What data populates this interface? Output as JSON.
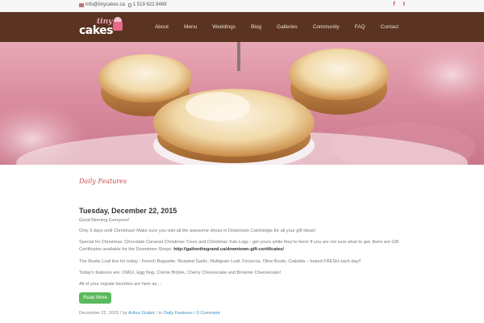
{
  "topbar": {
    "email": "info@tinycakes.ca",
    "phone": "1 519 622 8469",
    "social": [
      {
        "icon": "facebook-icon",
        "glyph": "f"
      },
      {
        "icon": "twitter-icon",
        "glyph": "t"
      }
    ]
  },
  "logo": {
    "word_top": "tiny",
    "word_main": "cakes"
  },
  "nav": {
    "items": [
      "About",
      "Menu",
      "Weddings",
      "Blog",
      "Galleries",
      "Community",
      "FAQ",
      "Contact"
    ]
  },
  "content": {
    "section_title": "Daily Features",
    "post_title": "Tuesday, December 22, 2015",
    "p1": "Good Morning Everyone!",
    "p2": "Only 3 days until Christmas! Make sure you visit all the awesome shops in Downtown Cambridge for all your gift ideas!",
    "p3": "Special for Christmas: Chocolate Caramel Christmas Trees and Christmas Yule Logs - get yours while they're here! If you are not sure what to get, there are Gift Certificates available for the Downtown Shops:",
    "p3_link": "http://galtonthegrand.ca/downtown-gift-certificates/",
    "p4": "The Rustic Loaf line for today - French Baguette, Roasted Garlic, Multigrain Loaf, Focaccia, Olive Boule, Ciabatta – baked FRESH each day!!",
    "p5": "Today's features are: OMG!, Egg Nog, Crème Brûlée, Cherry Cheesecake and Brownie Cheesecake!",
    "p6": "All of your regular favorites are here as ...",
    "read_more": "Read More",
    "meta": {
      "date": "December 22, 2015",
      "by_prefix": "/ by",
      "author": "Arthur Grabic",
      "in_prefix": "/ in",
      "category": "Daily Features",
      "sep": "/",
      "comments": "0 Comment"
    }
  },
  "colors": {
    "header_bg": "#5a3420",
    "accent_red": "#c84b4b",
    "link_blue": "#3a8fc4",
    "button_green": "#5cb85c"
  }
}
